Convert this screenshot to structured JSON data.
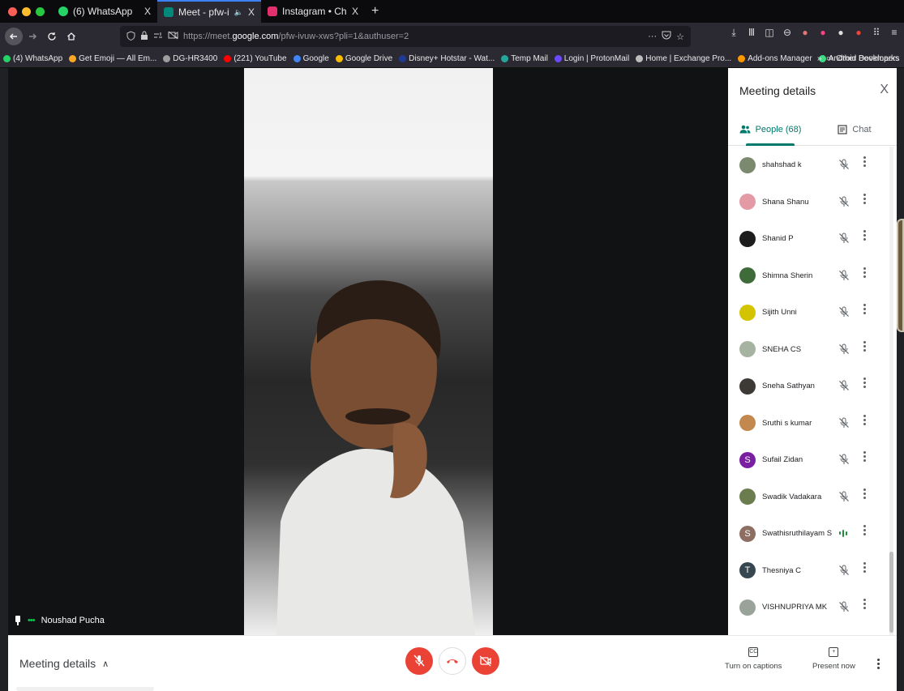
{
  "browser": {
    "tabs": [
      {
        "label": "(6) WhatsApp",
        "close": "X",
        "favicon_color": "#25d366"
      },
      {
        "label": "Meet - pfw-ivuw-xws",
        "close": "X",
        "favicon_color": "#00897b"
      },
      {
        "label": "Instagram • Chats",
        "close": "X",
        "favicon_color": "#e1306c"
      }
    ],
    "new_tab": "+",
    "url_prefix": "https://meet.",
    "url_host": "google.com",
    "url_path": "/pfw-ivuw-xws?pli=1&authuser=2",
    "url_menu": "···",
    "bookmarks": [
      {
        "label": "(4) WhatsApp",
        "color": "#25d366"
      },
      {
        "label": "Get Emoji — All Em...",
        "color": "#f9a825"
      },
      {
        "label": "DG-HR3400",
        "color": "#9e9e9e"
      },
      {
        "label": "(221) YouTube",
        "color": "#ff0000"
      },
      {
        "label": "Google",
        "color": "#4285f4"
      },
      {
        "label": "Google Drive",
        "color": "#fbbc04"
      },
      {
        "label": "Disney+ Hotstar - Wat...",
        "color": "#1f3a93"
      },
      {
        "label": "Temp Mail",
        "color": "#26a69a"
      },
      {
        "label": "Login | ProtonMail",
        "color": "#6d4aff"
      },
      {
        "label": "Home | Exchange Pro...",
        "color": "#bdbdbd"
      },
      {
        "label": "Add-ons Manager",
        "color": "#ff9800"
      },
      {
        "label": "Android Developers",
        "color": "#3ddc84"
      }
    ],
    "other_bookmarks": "Other Bookmarks",
    "overflow": "»"
  },
  "stage": {
    "speaker_name": "Noushad Pucha",
    "speaker_dots": "•••"
  },
  "panel": {
    "title": "Meeting details",
    "close": "X",
    "tab_people": "People (68)",
    "tab_chat": "Chat",
    "people": [
      {
        "name": "shahshad k",
        "avatar_color": "#7b8a6f",
        "initial": "",
        "state": "muted"
      },
      {
        "name": "Shana Shanu",
        "avatar_color": "#e39aa5",
        "initial": "",
        "state": "muted"
      },
      {
        "name": "Shanid P",
        "avatar_color": "#1d1d1d",
        "initial": "",
        "state": "muted"
      },
      {
        "name": "Shimna Sherin",
        "avatar_color": "#3f6b3a",
        "initial": "",
        "state": "muted"
      },
      {
        "name": "Sijith Unni",
        "avatar_color": "#d4c400",
        "initial": "",
        "state": "muted"
      },
      {
        "name": "SNEHA CS",
        "avatar_color": "#a7b3a1",
        "initial": "",
        "state": "muted"
      },
      {
        "name": "Sneha Sathyan",
        "avatar_color": "#3d3a35",
        "initial": "",
        "state": "muted"
      },
      {
        "name": "Sruthi s kumar",
        "avatar_color": "#c2884e",
        "initial": "",
        "state": "muted"
      },
      {
        "name": "Sufail Zidan",
        "avatar_color": "#7b1fa2",
        "initial": "S",
        "state": "muted"
      },
      {
        "name": "Swadik Vadakara",
        "avatar_color": "#6b7d4e",
        "initial": "",
        "state": "muted"
      },
      {
        "name": "Swathisruthilayam S",
        "avatar_color": "#8d6e63",
        "initial": "S",
        "state": "speaking"
      },
      {
        "name": "Thesniya C",
        "avatar_color": "#37474f",
        "initial": "T",
        "state": "muted"
      },
      {
        "name": "VISHNUPRIYA MK",
        "avatar_color": "#9aa39a",
        "initial": "",
        "state": "muted"
      }
    ]
  },
  "bottombar": {
    "meeting_details": "Meeting details",
    "captions_label": "Turn on captions",
    "captions_icon": "CC",
    "present_label": "Present now",
    "present_icon": "+"
  }
}
